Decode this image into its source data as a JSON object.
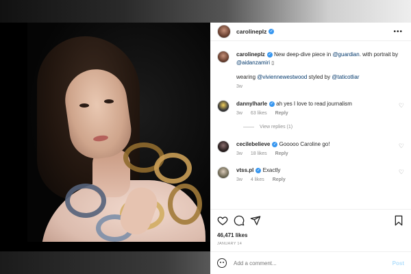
{
  "post": {
    "author": "carolineplz",
    "more_icon": "more-horizontal-icon"
  },
  "caption": {
    "author": "carolineplz",
    "text_1": "New deep-dive piece in",
    "mention_1": "@guardian",
    "text_2": ". with portrait by",
    "mention_2": "@aidanzamiri",
    "text_3": "wearing",
    "mention_3": "@viviennewestwood",
    "text_4": "styled by",
    "mention_4": "@taticotliar",
    "time": "3w"
  },
  "comments": [
    {
      "user": "dannylharle",
      "text": "ah yes I love to read journalism",
      "time": "3w",
      "likes": "63 likes",
      "reply": "Reply"
    },
    {
      "user": "cecilebelieve",
      "text": "Gooooo Caroline go!",
      "time": "3w",
      "likes": "18 likes",
      "reply": "Reply"
    },
    {
      "user": "vtss.pl",
      "text": "Exactly",
      "time": "3w",
      "likes": "4 likes",
      "reply": "Reply"
    }
  ],
  "view_replies": "View replies (1)",
  "actions": {
    "likes": "46,471 likes",
    "date": "JANUARY 14"
  },
  "add_comment": {
    "placeholder": "Add a comment...",
    "post_label": "Post"
  },
  "colors": {
    "link": "#00376b",
    "verified": "#3897f0",
    "post_button": "#b2dffc"
  }
}
